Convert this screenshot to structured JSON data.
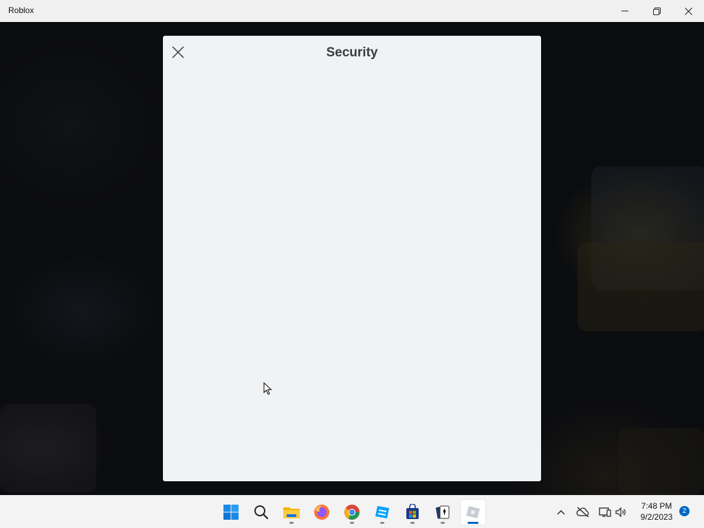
{
  "window": {
    "title": "Roblox",
    "controls": [
      "minimize",
      "restore",
      "close"
    ]
  },
  "dialog": {
    "title": "Security",
    "close_icon": "close-icon"
  },
  "taskbar": {
    "apps": [
      {
        "name": "Start",
        "icon": "windows-logo-icon"
      },
      {
        "name": "Search",
        "icon": "search-icon"
      },
      {
        "name": "File Explorer",
        "icon": "folder-icon"
      },
      {
        "name": "Firefox",
        "icon": "firefox-icon"
      },
      {
        "name": "Chrome",
        "icon": "chrome-icon"
      },
      {
        "name": "Roblox Studio",
        "icon": "roblox-studio-icon"
      },
      {
        "name": "Microsoft Store",
        "icon": "store-icon"
      },
      {
        "name": "Solitaire",
        "icon": "cards-icon"
      },
      {
        "name": "Roblox",
        "icon": "roblox-icon",
        "active": true
      }
    ],
    "tray": {
      "time": "7:48 PM",
      "date": "9/2/2023",
      "notifications": "2"
    }
  },
  "colors": {
    "accent": "#0067c0",
    "dialog_bg": "#f1f2f4",
    "title_text": "#393b3d"
  }
}
